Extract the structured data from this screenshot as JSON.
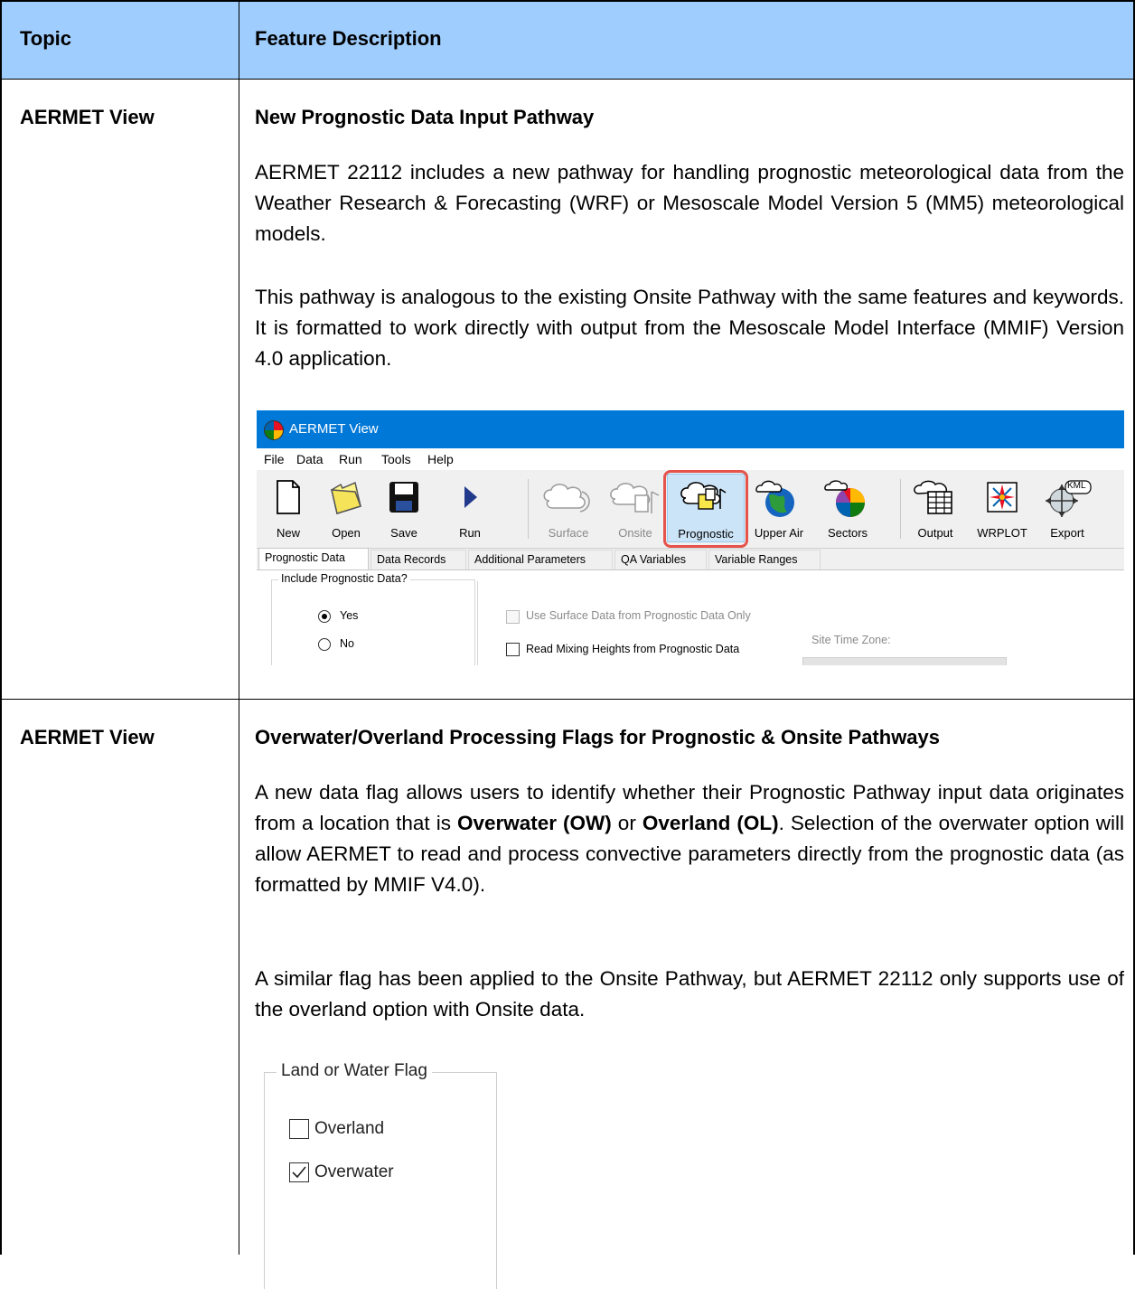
{
  "table": {
    "headers": {
      "topic": "Topic",
      "feature": "Feature Description"
    },
    "rows": [
      {
        "topic": "AERMET View",
        "feature_title": "New Prognostic Data Input Pathway",
        "paragraphs": [
          "AERMET 22112 includes a new pathway for handling prognostic meteorological data from the Weather Research & Forecasting (WRF) or Mesoscale Model Version 5 (MM5) meteorological models.",
          "This pathway is analogous to the existing Onsite Pathway with the same features and keywords. It is formatted to work directly with output from the Mesoscale Model Interface (MMIF) Version 4.0 application."
        ]
      },
      {
        "topic": "AERMET View",
        "feature_title": "Overwater/Overland Processing Flags for Prognostic & Onsite Pathways",
        "p1_a": "A new data flag allows users to identify whether their Prognostic Pathway input data originates from a location that is ",
        "p1_bold1": "Overwater (OW)",
        "p1_or": " or ",
        "p1_bold2": "Overland (OL)",
        "p1_b": ". Selection of the overwater option will allow AERMET to read and process convective parameters directly from the prognostic data (as formatted by MMIF V4.0).",
        "p2": "A similar flag has been applied to the Onsite Pathway, but AERMET 22112 only supports use of the overland option with Onsite data."
      }
    ]
  },
  "aermet_window": {
    "title": "AERMET View",
    "menu": [
      "File",
      "Data",
      "Run",
      "Tools",
      "Help"
    ],
    "toolbar": {
      "new": "New",
      "open": "Open",
      "save": "Save",
      "run": "Run",
      "surface": "Surface",
      "onsite": "Onsite",
      "prognostic": "Prognostic",
      "upper_air": "Upper Air",
      "sectors": "Sectors",
      "output": "Output",
      "wrplot": "WRPLOT",
      "export": "Export",
      "kml_badge": "KML"
    },
    "tabs": [
      "Prognostic Data",
      "Data Records",
      "Additional Parameters",
      "QA Variables",
      "Variable Ranges"
    ],
    "active_tab": "Prognostic Data",
    "include_group": {
      "title": "Include Prognostic Data?",
      "yes": "Yes",
      "no": "No",
      "selected": "Yes"
    },
    "use_surface_label": "Use Surface Data from Prognostic Data Only",
    "read_mixing_label": "Read Mixing Heights from Prognostic Data",
    "site_tz_label": "Site Time Zone:"
  },
  "land_water_flag": {
    "title": "Land or Water Flag",
    "overland": "Overland",
    "overwater": "Overwater",
    "overland_checked": false,
    "overwater_checked": true
  },
  "colors": {
    "header_bg": "#9fcdfd",
    "titlebar": "#0078d7",
    "highlight": "#e5534b"
  }
}
